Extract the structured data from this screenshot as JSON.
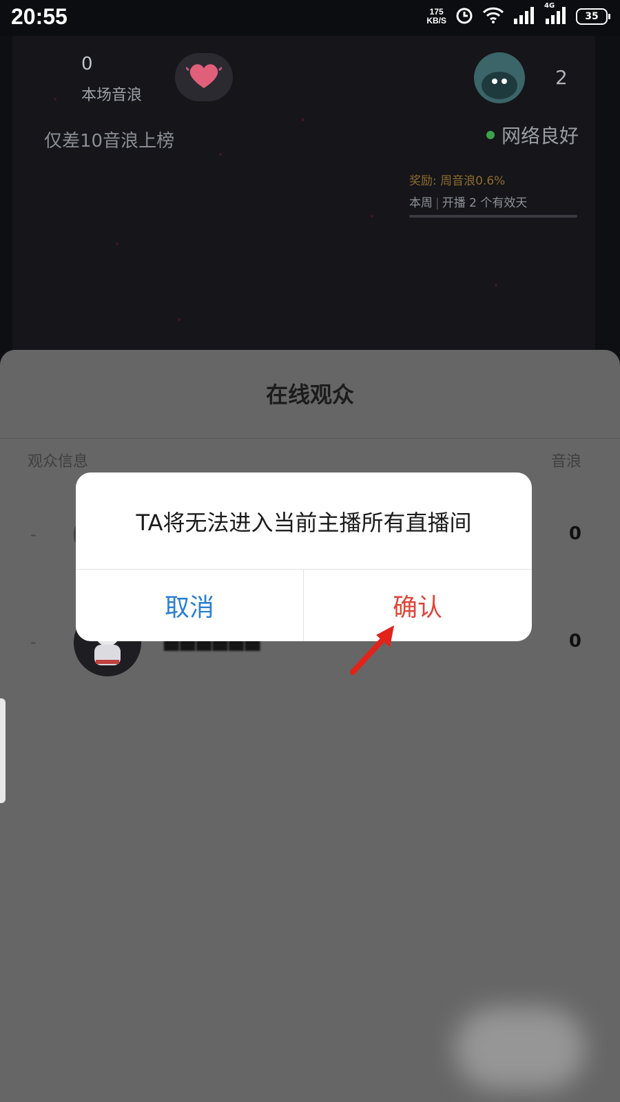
{
  "status_bar": {
    "time": "20:55",
    "net_speed_value": "175",
    "net_speed_unit": "KB/S",
    "battery": "35",
    "network_type": "4G"
  },
  "live_header": {
    "session_count": "0",
    "session_label": "本场音浪",
    "rank_hint": "仅差10音浪上榜",
    "viewer_count": "2",
    "network_status": "网络良好",
    "reward_text": "奖励: 周音浪0.6%",
    "week_prefix": "本周",
    "week_text": "开播 2 个有效天"
  },
  "audience_sheet": {
    "title": "在线观众",
    "col_info": "观众信息",
    "col_wave": "音浪",
    "rows": [
      {
        "rank": "-",
        "value": "0"
      },
      {
        "rank": "-",
        "value": "0"
      }
    ]
  },
  "dialog": {
    "message": "TA将无法进入当前主播所有直播间",
    "cancel": "取消",
    "confirm": "确认"
  },
  "colors": {
    "confirm": "#e0443a",
    "cancel": "#2b7fd0",
    "arrow": "#e2231a"
  }
}
